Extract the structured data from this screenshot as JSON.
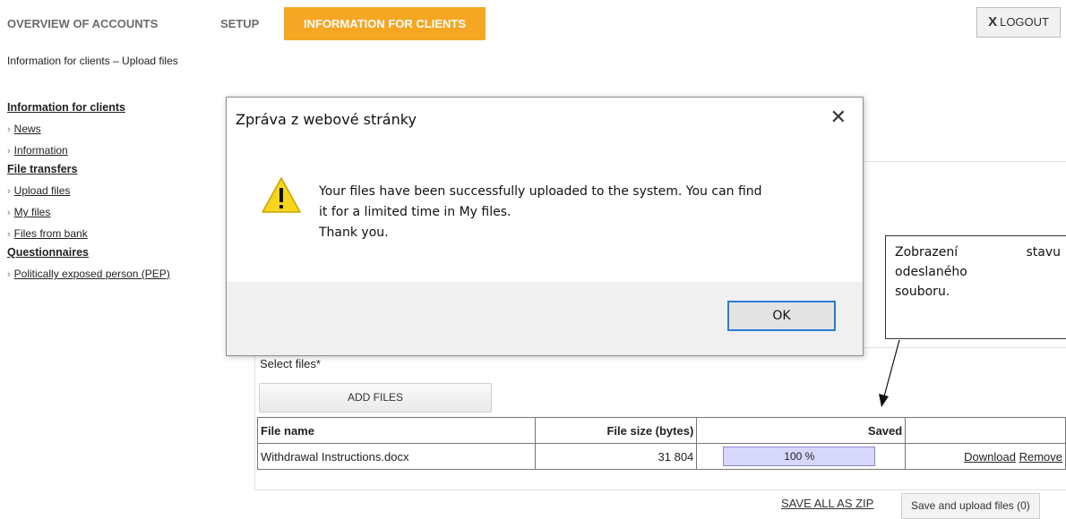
{
  "nav": {
    "tabs": [
      {
        "label": "OVERVIEW OF ACCOUNTS"
      },
      {
        "label": "SETUP"
      },
      {
        "label": "INFORMATION FOR CLIENTS",
        "active": true
      }
    ],
    "logout_x": "X",
    "logout_label": "LOGOUT"
  },
  "breadcrumb": "Information for clients – Upload files",
  "sidebar": {
    "sections": [
      {
        "title": "Information for clients",
        "items": [
          {
            "label": "News"
          },
          {
            "label": "Information"
          }
        ]
      },
      {
        "title": "File transfers",
        "items": [
          {
            "label": "Upload files"
          },
          {
            "label": "My files"
          },
          {
            "label": "Files from bank"
          }
        ]
      },
      {
        "title": "Questionnaires",
        "items": [
          {
            "label": "Politically exposed person (PEP)"
          }
        ]
      }
    ],
    "chevron": "›"
  },
  "upload": {
    "select_label": "Select files*",
    "add_button": "ADD FILES",
    "table": {
      "headers": [
        "File name",
        "File size (bytes)",
        "Saved",
        ""
      ],
      "rows": [
        {
          "name": "Withdrawal Instructions.docx",
          "size": "31 804",
          "saved": "100 %",
          "progress": 100,
          "download": "Download",
          "remove": "Remove"
        }
      ]
    },
    "zip_link": "SAVE ALL AS ZIP",
    "upload_button": "Save and upload files (0)"
  },
  "callout": {
    "line1_left": "Zobrazení",
    "line1_right": "stavu",
    "line2": "odeslaného",
    "line3": "souboru."
  },
  "dialog": {
    "title": "Zpráva z webové stránky",
    "close_glyph": "✕",
    "message_line1": "Your files have been successfully uploaded to the system. You can find",
    "message_line2": "it for a limited time in My files.",
    "message_line3": "Thank you.",
    "ok_label": "OK"
  },
  "colors": {
    "accent": "#f5a623",
    "progress_fill": "#d7d7fb",
    "ok_border": "#2b7ad6",
    "warning_yellow": "#f7d51d"
  }
}
